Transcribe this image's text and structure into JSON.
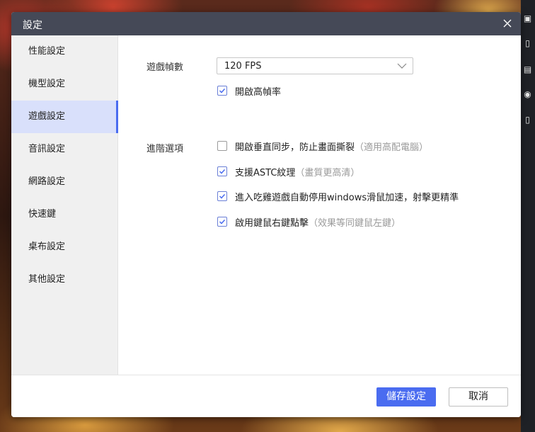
{
  "dialog": {
    "title": "設定"
  },
  "sidebar": {
    "items": [
      {
        "label": "性能設定"
      },
      {
        "label": "機型設定"
      },
      {
        "label": "遊戲設定",
        "active": true
      },
      {
        "label": "音訊設定"
      },
      {
        "label": "網路設定"
      },
      {
        "label": "快速鍵"
      },
      {
        "label": "桌布設定"
      },
      {
        "label": "其他設定"
      }
    ]
  },
  "game": {
    "fps_label": "遊戲幀數",
    "fps_value": "120 FPS",
    "high_fps": {
      "label": "開啟高幀率",
      "checked": true
    },
    "advanced_label": "進階選項",
    "options": [
      {
        "label": "開啟垂直同步，防止畫面撕裂",
        "hint": "（適用高配電腦）",
        "checked": false
      },
      {
        "label": "支援ASTC紋理",
        "hint": "（畫質更高清）",
        "checked": true
      },
      {
        "label": "進入吃雞遊戲自動停用windows滑鼠加速，射擊更精準",
        "hint": "",
        "checked": true
      },
      {
        "label": "啟用鍵鼠右鍵點擊",
        "hint": "（效果等同鍵鼠左鍵）",
        "checked": true
      }
    ]
  },
  "footer": {
    "save_label": "儲存設定",
    "cancel_label": "取消"
  },
  "colors": {
    "accent": "#4a6cf0",
    "titlebar": "#454957",
    "sidebar_active": "#d9e0fb"
  }
}
